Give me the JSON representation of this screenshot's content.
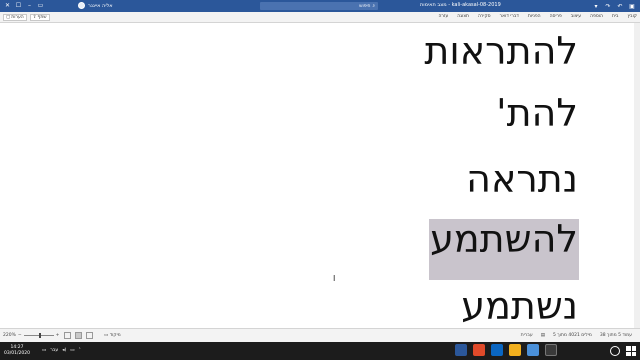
{
  "titlebar": {
    "user_name": "אליה אייגנר",
    "search_placeholder": "חיפוש",
    "document_title": "kali-akasal-08-2019 - מצב תאימות",
    "minimize_glyph": "–",
    "maximize_glyph": "☐",
    "close_glyph": "✕"
  },
  "ribbon": {
    "comments_label": "הערות",
    "share_label": "שתף",
    "tabs": [
      "קובץ",
      "בית",
      "הוספה",
      "עיצוב",
      "פריסה",
      "הפניות",
      "דברי דואר",
      "סקירה",
      "תצוגה",
      "עזרה"
    ]
  },
  "document": {
    "lines": [
      "להתראות",
      "להת'",
      "נתראה",
      "להשתמע",
      "נשתמע"
    ],
    "selected_index": 3
  },
  "statusbar": {
    "zoom": "220%",
    "zoom_minus": "−",
    "zoom_plus": "+",
    "focus_label": "מיקוד",
    "page_info": "עמוד 5 מתוך 38",
    "word_count": "מילים 4021 מתוך 5",
    "language": "עברית"
  },
  "taskbar": {
    "time": "14:27",
    "date": "03/01/2020",
    "lang_indicator": "עבר"
  },
  "colors": {
    "accent": "#2b579a",
    "selection": "#c9c4cc"
  }
}
